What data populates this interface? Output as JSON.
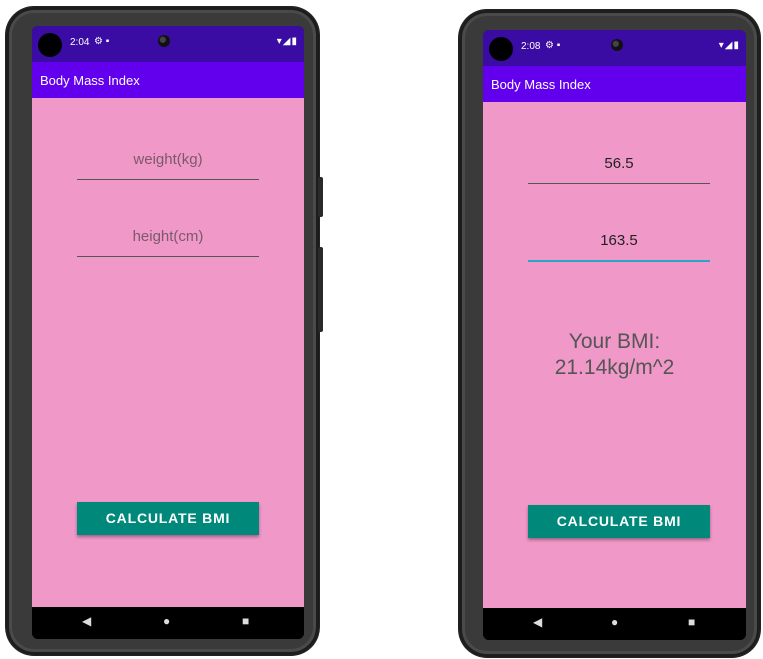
{
  "app": {
    "title": "Body Mass Index"
  },
  "left": {
    "status": {
      "time": "2:04",
      "icons": "⚙ ▪",
      "system": "▾◢▮"
    },
    "weight": {
      "value": "",
      "placeholder": "weight(kg)"
    },
    "height": {
      "value": "",
      "placeholder": "height(cm)"
    },
    "button_label": "CALCULATE BMI"
  },
  "right": {
    "status": {
      "time": "2:08",
      "icons": "⚙ ▪",
      "system": "▾◢▮"
    },
    "weight": {
      "value": "56.5",
      "placeholder": "weight(kg)"
    },
    "height": {
      "value": "163.5",
      "placeholder": "height(cm)"
    },
    "result_line1": "Your BMI:",
    "result_line2": "21.14kg/m^2",
    "button_label": "CALCULATE BMI"
  },
  "nav": {
    "back": "◀",
    "home": "●",
    "recents": "■"
  },
  "colors": {
    "status_bar": "#3a0ca3",
    "app_bar": "#6200ee",
    "background": "#f098c8",
    "button": "#00897b",
    "focus_line": "#26a6c9"
  }
}
